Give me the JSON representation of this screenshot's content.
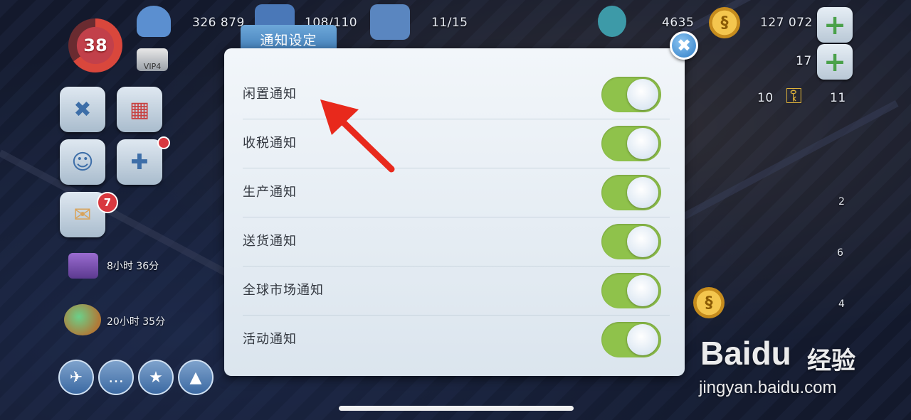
{
  "hud": {
    "level": "38",
    "population": "326 879",
    "storage": "108/110",
    "construction": "11/15",
    "simcash": "4635",
    "simoleons": "127 072",
    "keys_a": "17",
    "keys_b": "10",
    "keys_c": "11",
    "vip": "VIP4"
  },
  "sidebar": {
    "mail_badge": "7",
    "timer_1": "8小时 36分",
    "timer_2": "20小时 35分"
  },
  "map_counts": [
    "2",
    "6",
    "4"
  ],
  "dialog": {
    "title": "通知设定",
    "close_symbol": "✖",
    "rows": [
      {
        "label": "闲置通知",
        "enabled": true
      },
      {
        "label": "收税通知",
        "enabled": true
      },
      {
        "label": "生产通知",
        "enabled": true
      },
      {
        "label": "送货通知",
        "enabled": true
      },
      {
        "label": "全球市场通知",
        "enabled": true
      },
      {
        "label": "活动通知",
        "enabled": true
      }
    ]
  },
  "watermark": {
    "logo": "Baidu",
    "cn": "经验",
    "url": "jingyan.baidu.com"
  },
  "colors": {
    "toggle_on": "#8fc24b",
    "dialog_tab": "#4f8cc4",
    "arrow": "#e8291c"
  }
}
